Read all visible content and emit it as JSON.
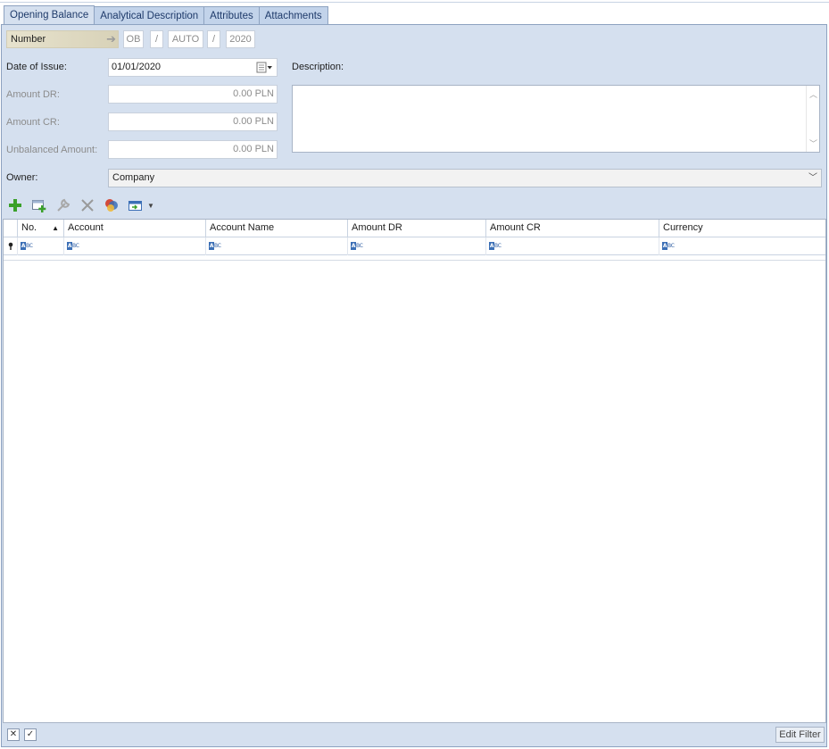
{
  "tabs": [
    {
      "label": "Opening Balance",
      "active": true
    },
    {
      "label": "Analytical Description",
      "active": false
    },
    {
      "label": "Attributes",
      "active": false
    },
    {
      "label": "Attachments",
      "active": false
    }
  ],
  "number": {
    "label": "Number",
    "prefix": "OB",
    "sep1": "/",
    "auto": "AUTO",
    "sep2": "/",
    "year": "2020"
  },
  "form": {
    "date_label": "Date of Issue:",
    "date_value": "01/01/2020",
    "description_label": "Description:",
    "amount_dr_label": "Amount DR:",
    "amount_dr_value": "0.00 PLN",
    "amount_cr_label": "Amount CR:",
    "amount_cr_value": "0.00 PLN",
    "unbalanced_label": "Unbalanced Amount:",
    "unbalanced_value": "0.00 PLN",
    "owner_label": "Owner:",
    "owner_value": "Company"
  },
  "toolbar": {
    "icons": [
      "add-icon",
      "add-from-list-icon",
      "edit-icon",
      "delete-icon",
      "colors-icon",
      "export-icon"
    ]
  },
  "grid": {
    "columns": [
      "No.",
      "Account",
      "Account Name",
      "Amount DR",
      "Amount CR",
      "Currency"
    ],
    "filter_glyph": "ABC"
  },
  "footer": {
    "edit_filter_label": "Edit Filter"
  },
  "colors": {
    "panel_bg": "#d5e0ef",
    "tab_border": "#8da2c0",
    "accent_green": "#3aa02a"
  }
}
